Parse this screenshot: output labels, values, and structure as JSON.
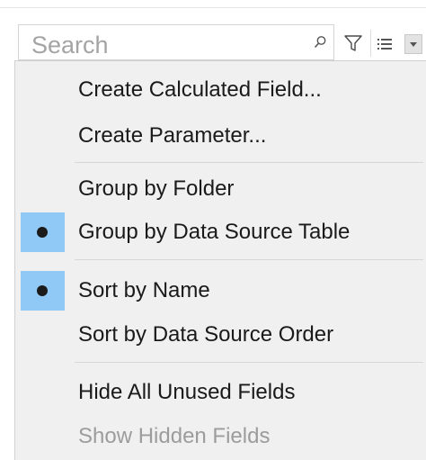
{
  "search": {
    "placeholder": "Search",
    "value": ""
  },
  "icons": {
    "search": "search-icon",
    "filter": "filter-icon",
    "view": "view-options-icon",
    "dropdown": "chevron-down-icon"
  },
  "menu": {
    "create_calculated_field": "Create Calculated Field...",
    "create_parameter": "Create Parameter...",
    "group_by_folder": "Group by Folder",
    "group_by_data_source_table": "Group by Data Source Table",
    "sort_by_name": "Sort by Name",
    "sort_by_data_source_order": "Sort by Data Source Order",
    "hide_all_unused_fields": "Hide All Unused Fields",
    "show_hidden_fields": "Show Hidden Fields"
  },
  "state": {
    "group_selected": "Group by Data Source Table",
    "sort_selected": "Sort by Name",
    "show_hidden_fields_enabled": false
  },
  "colors": {
    "menu_background": "#f0f0f0",
    "check_highlight": "#90c8f6",
    "disabled_text": "#9c9c9c"
  }
}
